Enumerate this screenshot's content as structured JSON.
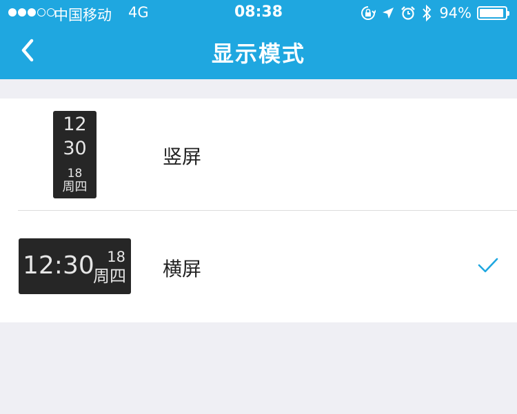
{
  "status_bar": {
    "signal": [
      "full",
      "full",
      "full",
      "empty",
      "empty"
    ],
    "carrier": "中国移动",
    "network": "4G",
    "time": "08:38",
    "icons": [
      "rotation-lock-icon",
      "location-icon",
      "alarm-icon",
      "bluetooth-icon"
    ],
    "battery_percent": "94%",
    "battery_level": 0.94
  },
  "nav": {
    "back_icon": "chevron-left-icon",
    "title": "显示模式"
  },
  "modes": [
    {
      "label": "竖屏",
      "selected": false,
      "preview": {
        "hour": "12",
        "minute": "30",
        "date": "18",
        "weekday": "周四"
      }
    },
    {
      "label": "横屏",
      "selected": true,
      "preview": {
        "time": "12:30",
        "date": "18",
        "weekday": "周四"
      }
    }
  ],
  "colors": {
    "accent": "#1fa7e0",
    "preview_bg": "#262626",
    "background": "#efeff4"
  }
}
